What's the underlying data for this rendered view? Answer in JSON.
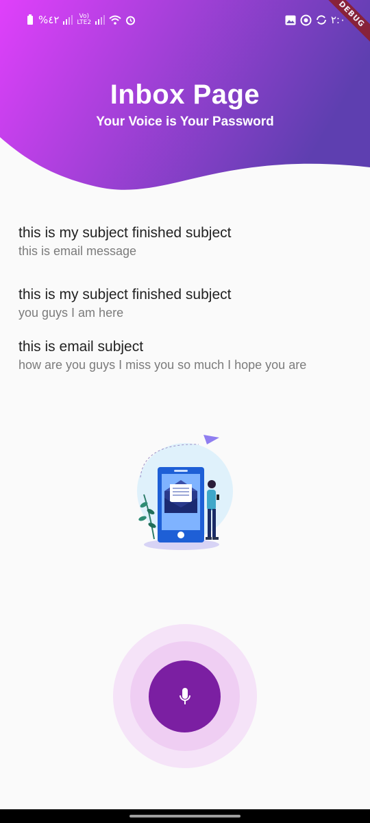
{
  "status_bar": {
    "battery": "%٤٢",
    "network": "LTE2",
    "volte": "Vo)",
    "time": "٢:٠"
  },
  "debug_banner": "DEBUG",
  "header": {
    "title": "Inbox Page",
    "subtitle": "Your Voice is Your Password",
    "gradient_start": "#e040fb",
    "gradient_end": "#5e3fb0"
  },
  "emails": [
    {
      "subject": "this is my subject finished subject",
      "message": "this is email message"
    },
    {
      "subject": "this is my subject finished subject",
      "message": "you guys I am here"
    },
    {
      "subject": "this is email subject",
      "message": "how are you guys I miss you so much I hope you are"
    }
  ],
  "illustration": "email-phone-illustration",
  "mic_button": {
    "icon": "mic-icon",
    "color": "#7b1fa2"
  }
}
